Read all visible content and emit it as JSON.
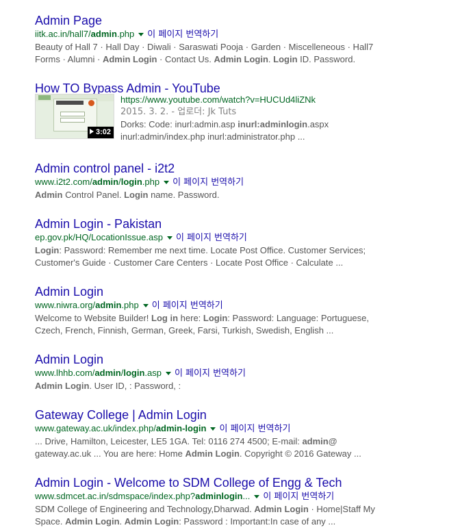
{
  "results": [
    {
      "title": "Admin Page",
      "url_pre": "iitk.ac.in/hall7/",
      "url_bold": "admin",
      "url_post": ".php",
      "translate": "이 페이지 번역하기",
      "snippet_l1": "Beauty of Hall 7 · Hall Day · Diwali · Saraswati Pooja · Garden · Miscelleneous · Hall7",
      "snippet_l2_a": "Forms · Alumni · ",
      "snippet_l2_b1": "Admin Login",
      "snippet_l2_c": " · Contact Us. ",
      "snippet_l2_b2": "Admin Login",
      "snippet_l2_d": ". ",
      "snippet_l2_b3": "Login",
      "snippet_l2_e": " ID. Password."
    },
    {
      "title": "How TO Bypass Admin - YouTube",
      "url": "https://www.youtube.com/watch?v=HUCUd4liZNk",
      "meta": "2015. 3. 2. - 업로더: Jk Tuts",
      "duration": "3:02",
      "snippet_l1_a": "Dorks: Code: inurl:admin.asp ",
      "snippet_l1_b": "inurl:adminlogin",
      "snippet_l1_c": ".aspx",
      "snippet_l2": "inurl:admin/index.php inurl:administrator.php ..."
    },
    {
      "title": "Admin control panel - i2t2",
      "url_pre": "www.i2t2.com/",
      "url_bold1": "admin",
      "url_mid": "/",
      "url_bold2": "login",
      "url_post": ".php",
      "translate": "이 페이지 번역하기",
      "snippet_b1": "Admin",
      "snippet_a": " Control Panel. ",
      "snippet_b2": "Login",
      "snippet_c": " name. Password."
    },
    {
      "title": "Admin Login - Pakistan",
      "url": "ep.gov.pk/HQ/LocationIssue.asp",
      "translate": "이 페이지 번역하기",
      "snippet_b1": "Login",
      "snippet_l1": ": Password: Remember me next time. Locate Post Office. Customer Services;",
      "snippet_l2": "Customer's Guide · Customer Care Centers · Locate Post Office · Calculate ..."
    },
    {
      "title": "Admin Login",
      "url_pre": "www.niwra.org/",
      "url_bold": "admin",
      "url_post": ".php",
      "translate": "이 페이지 번역하기",
      "snippet_l1_a": "Welcome to Website Builder! ",
      "snippet_l1_b": "Log in",
      "snippet_l1_c": " here: ",
      "snippet_l1_d": "Login",
      "snippet_l1_e": ": Password: Language: Portuguese,",
      "snippet_l2": "Czech, French, Finnish, German, Greek, Farsi, Turkish, Swedish, English ..."
    },
    {
      "title": "Admin Login",
      "url_pre": "www.lhhb.com/",
      "url_bold1": "admin",
      "url_mid": "/",
      "url_bold2": "login",
      "url_post": ".asp",
      "translate": "이 페이지 번역하기",
      "snippet_b": "Admin Login",
      "snippet_a": ". User ID, : Password, :"
    },
    {
      "title": "Gateway College | Admin Login",
      "url_pre": "www.gateway.ac.uk/index.php/",
      "url_bold": "admin-login",
      "translate": "이 페이지 번역하기",
      "snippet_l1_a": "... Drive, Hamilton, Leicester, LE5 1GA. Tel: 0116 274 4500; E-mail: ",
      "snippet_l1_b": "admin@",
      "snippet_l2_a": "gateway.ac.uk ... You are here: Home ",
      "snippet_l2_b": "Admin Login",
      "snippet_l2_c": ". Copyright © 2016 Gateway ..."
    },
    {
      "title": "Admin Login - Welcome to SDM College of Engg & Tech",
      "url_pre": "www.sdmcet.ac.in/sdmspace/index.php?",
      "url_bold": "adminlogin",
      "url_post": "...",
      "translate": "이 페이지 번역하기",
      "snippet_l1_a": "SDM College of Engineering and Technology,Dharwad. ",
      "snippet_l1_b": "Admin Login",
      "snippet_l1_c": " · Home|Staff My",
      "snippet_l2_a": "Space. ",
      "snippet_l2_b1": "Admin Login",
      "snippet_l2_c": ". ",
      "snippet_l2_b2": "Admin Login",
      "snippet_l2_d": ": Password : Important:In case of any ..."
    }
  ]
}
